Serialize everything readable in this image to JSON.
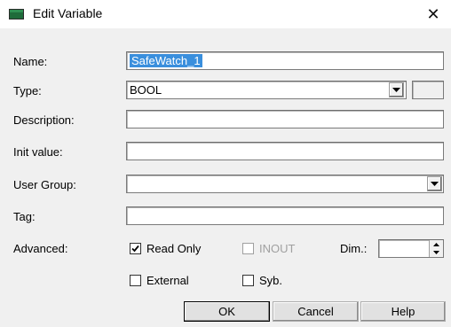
{
  "window": {
    "title": "Edit Variable",
    "close_glyph": "✕"
  },
  "form": {
    "name": {
      "label": "Name:",
      "value": "SafeWatch_1"
    },
    "type": {
      "label": "Type:",
      "value": "BOOL"
    },
    "description": {
      "label": "Description:",
      "value": ""
    },
    "init_value": {
      "label": "Init value:",
      "value": ""
    },
    "user_group": {
      "label": "User Group:",
      "value": ""
    },
    "tag": {
      "label": "Tag:",
      "value": ""
    },
    "advanced": {
      "label": "Advanced:"
    }
  },
  "options": {
    "read_only": {
      "label": "Read Only",
      "checked": true
    },
    "inout": {
      "label": "INOUT",
      "checked": false,
      "disabled": true
    },
    "dim": {
      "label": "Dim.:",
      "value": ""
    },
    "external": {
      "label": "External",
      "checked": false
    },
    "syb": {
      "label": "Syb.",
      "checked": false
    }
  },
  "buttons": {
    "ok": "OK",
    "cancel": "Cancel",
    "help": "Help"
  },
  "colors": {
    "selection": "#3a8fdd",
    "dialog_bg": "#f0f0f0"
  },
  "icons": {
    "title": "variable-window-icon",
    "close": "close-icon",
    "dropdown": "chevron-down-icon",
    "spin": "spin-arrows-icon",
    "check": "checkmark-icon"
  }
}
